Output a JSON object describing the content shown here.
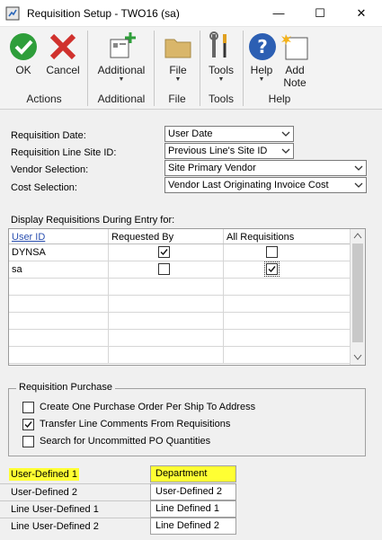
{
  "window": {
    "title": "Requisition Setup  -  TWO16 (sa)",
    "minimize": "—",
    "maximize": "☐",
    "close": "✕"
  },
  "ribbon": {
    "ok": "OK",
    "cancel": "Cancel",
    "additional": "Additional",
    "file": "File",
    "tools": "Tools",
    "help": "Help",
    "add_note": "Add Note",
    "add_note_line1": "Add",
    "add_note_line2": "Note",
    "groups": {
      "actions": "Actions",
      "additional": "Additional",
      "file": "File",
      "tools": "Tools",
      "help": "Help"
    }
  },
  "form": {
    "requisition_date": {
      "label": "Requisition Date:",
      "value": "User Date"
    },
    "line_site": {
      "label": "Requisition Line Site ID:",
      "value": "Previous Line's Site ID"
    },
    "vendor_selection": {
      "label": "Vendor Selection:",
      "value": "Site Primary Vendor"
    },
    "cost_selection": {
      "label": "Cost Selection:",
      "value": "Vendor Last Originating Invoice Cost"
    }
  },
  "display_grid": {
    "caption": "Display Requisitions During Entry for:",
    "headers": [
      "User ID",
      "Requested By",
      "All Requisitions"
    ],
    "rows": [
      {
        "user": "DYNSA",
        "requested_by": true,
        "all": false
      },
      {
        "user": "sa",
        "requested_by": false,
        "all": true
      }
    ]
  },
  "purchase": {
    "title": "Requisition Purchase",
    "options": [
      {
        "label": "Create One Purchase Order Per Ship To Address",
        "checked": false
      },
      {
        "label": "Transfer Line Comments From Requisitions",
        "checked": true
      },
      {
        "label": "Search for Uncommitted PO Quantities",
        "checked": false
      }
    ]
  },
  "user_defined": [
    {
      "label": "User-Defined 1",
      "value": "Department"
    },
    {
      "label": "User-Defined 2",
      "value": "User-Defined 2"
    },
    {
      "label": "Line User-Defined 1",
      "value": "Line Defined 1"
    },
    {
      "label": "Line User-Defined 2",
      "value": "Line Defined 2"
    }
  ],
  "colors": {
    "highlight": "#ffff33",
    "ok_green": "#2e9e3a",
    "cancel_red": "#d0312d",
    "help_blue": "#2c5fb3"
  }
}
